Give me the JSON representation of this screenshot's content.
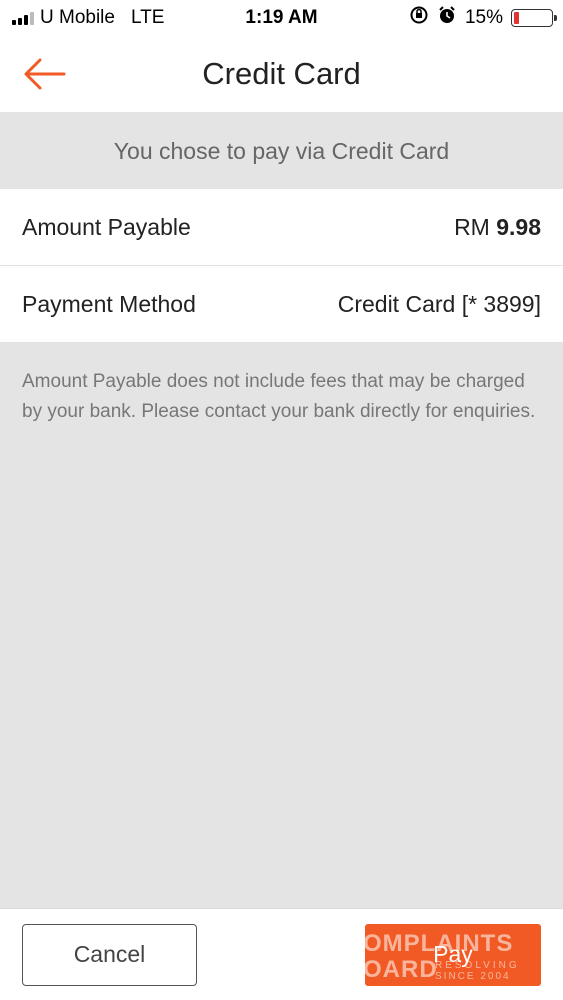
{
  "status_bar": {
    "carrier": "U Mobile",
    "network": "LTE",
    "time": "1:19 AM",
    "battery_percent": "15%",
    "battery_level": 0.15,
    "battery_color": "#e33333"
  },
  "nav": {
    "title": "Credit Card",
    "back_icon": "arrow-left-icon",
    "accent_color": "#f15a24"
  },
  "banner": {
    "text": "You chose to pay via Credit Card"
  },
  "rows": [
    {
      "label": "Amount Payable",
      "value_prefix": "RM ",
      "value": "9.98"
    },
    {
      "label": "Payment Method",
      "value": "Credit Card [* 3899]"
    }
  ],
  "note": "Amount Payable does not include fees that may be charged by your bank. Please contact your bank directly for enquiries.",
  "actions": {
    "cancel_label": "Cancel",
    "pay_label": "Pay"
  },
  "watermark": {
    "line1": "OMPLAINTS",
    "line2": "OARD",
    "small1": "RESOLVING",
    "small2": "SINCE 2004"
  }
}
